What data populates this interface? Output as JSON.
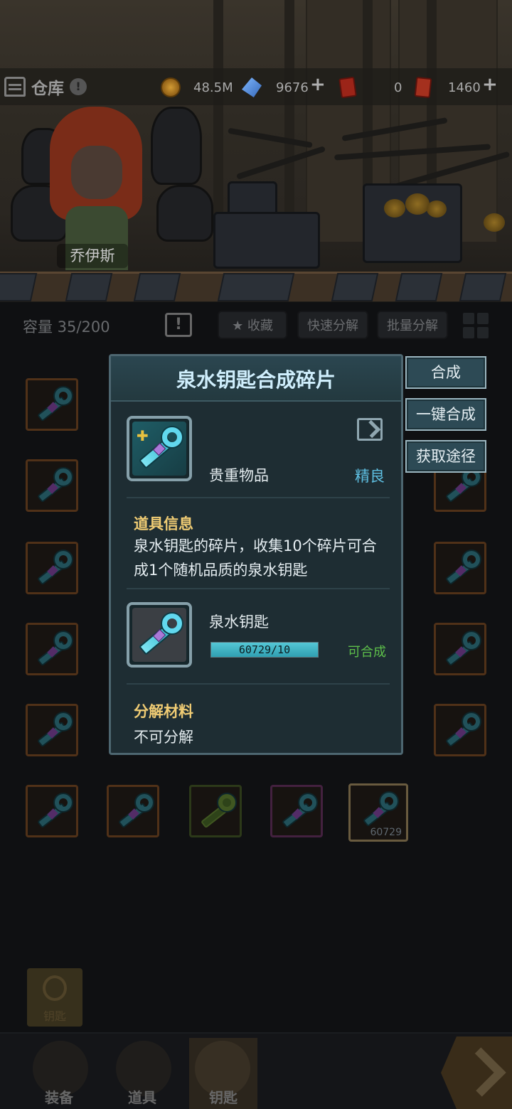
{
  "header": {
    "title": "仓库",
    "info_icon": "info-icon",
    "resources": [
      {
        "icon": "coin-icon",
        "value": "48.5M",
        "has_plus": false
      },
      {
        "icon": "gem-icon",
        "value": "9676",
        "has_plus": true
      },
      {
        "icon": "red-card-icon",
        "value": "0",
        "has_plus": false
      },
      {
        "icon": "ticket-icon",
        "value": "1460",
        "has_plus": true
      }
    ]
  },
  "hero": {
    "name": "乔伊斯"
  },
  "toolbar": {
    "capacity": "容量  35/200",
    "favorite": "★ 收藏",
    "quick_decompose": "快速分解",
    "batch_decompose": "批量分解"
  },
  "popup": {
    "title": "泉水钥匙合成碎片",
    "item_type": "贵重物品",
    "rarity": "精良",
    "info_heading": "道具信息",
    "description": "泉水钥匙的碎片，收集10个碎片可合成1个随机品质的泉水钥匙",
    "target_name": "泉水钥匙",
    "progress_text": "60729/10",
    "progress_fraction": 1.0,
    "status": "可合成",
    "decompose_heading": "分解材料",
    "decompose_text": "不可分解"
  },
  "side_buttons": {
    "combine": "合成",
    "one_click_combine": "一键合成",
    "obtain_ways": "获取途径"
  },
  "grid": {
    "selected_count": "60729"
  },
  "bottom": {
    "category_key": "钥匙",
    "nav": [
      "装备",
      "道具",
      "钥匙"
    ]
  },
  "colors": {
    "accent_title": "#cfeefc",
    "rarity": "#5fc1e4",
    "ready": "#5dbf4a",
    "heading": "#f0cc74"
  }
}
